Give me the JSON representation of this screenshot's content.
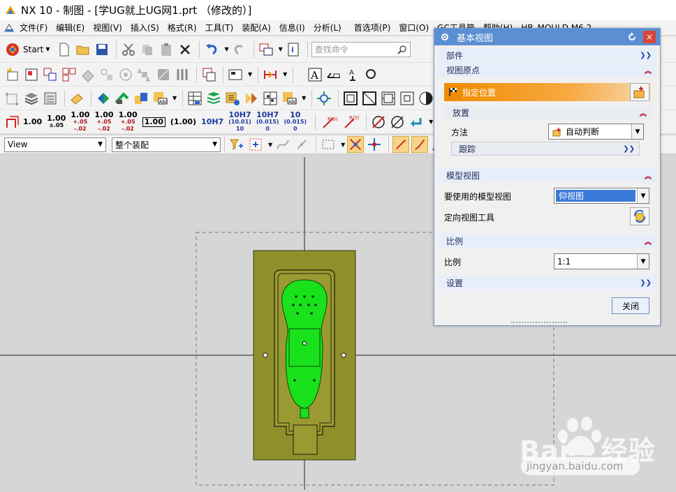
{
  "window": {
    "title": "NX 10 - 制图 - [学UG就上UG网1.prt （修改的）]"
  },
  "menubar": {
    "items": [
      "文件(F)",
      "编辑(E)",
      "视图(V)",
      "插入(S)",
      "格式(R)",
      "工具(T)",
      "装配(A)",
      "信息(I)",
      "分析(L)",
      "首选项(P)",
      "窗口(O)",
      "GC工具箱",
      "帮助(H)",
      "HB_MOULD M6.2"
    ]
  },
  "toolbar": {
    "start_label": "Start",
    "search_placeholder": "查找命令",
    "tolerances": [
      {
        "top": "1.00",
        "bottom": ""
      },
      {
        "top": "1.00",
        "bottom": "±.05"
      },
      {
        "top": "1.00",
        "bottom": "+.05\n-.02"
      },
      {
        "top": "1.00",
        "bottom": "+.05\n-.02"
      },
      {
        "top": "1.00",
        "bottom": "+.05\n-.02"
      }
    ],
    "box_value": "1.00",
    "paren_value": "(1.00)",
    "fit_labels": [
      {
        "top": "10H7",
        "bottom": ""
      },
      {
        "top": "10H7",
        "bottom": "(10.01)\n10"
      },
      {
        "top": "10H7",
        "bottom": "(0.015)\n0"
      },
      {
        "top": "10",
        "bottom": "(0.015)\n0"
      }
    ],
    "r_labels": [
      "R(0)",
      "R(0)"
    ]
  },
  "selection_bar": {
    "filter_value": "View",
    "scope_value": "整个装配"
  },
  "dialog": {
    "title": "基本视图",
    "sections": {
      "part": "部件",
      "view_origin": "视图原点",
      "specify_location": "指定位置",
      "placement": "放置",
      "method_label": "方法",
      "method_value": "自动判断",
      "tracking": "跟踪",
      "model_view": "模型视图",
      "model_view_label": "要使用的模型视图",
      "model_view_value": "仰视图",
      "orient_tool_label": "定向视图工具",
      "scale": "比例",
      "scale_label": "比例",
      "scale_value": "1:1",
      "settings": "设置"
    },
    "close_label": "关闭"
  },
  "watermark": {
    "brand": "Bai",
    "brand_cn": "经验",
    "url": "jingyan.baidu.com"
  },
  "colors": {
    "title_bar": "#5b8fd2",
    "accent_orange": "#f08a00",
    "selected_blue": "#3a79d8",
    "model_green": "#19e11b",
    "mold_base": "#8f8f2c",
    "arrow_red": "#ee2b2b"
  }
}
